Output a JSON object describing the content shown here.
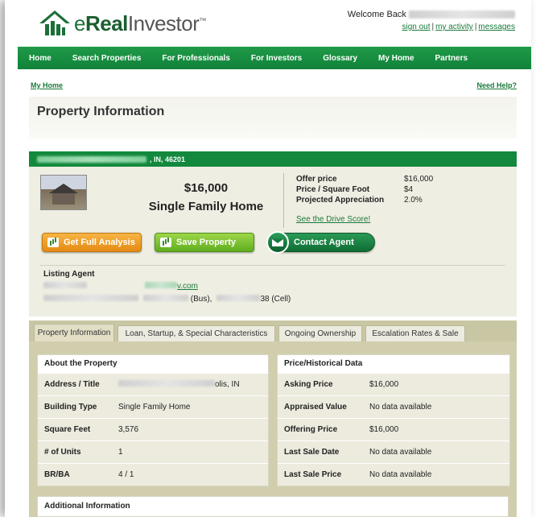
{
  "header": {
    "logo_brand": "Real",
    "logo_prefix": "e",
    "logo_suffix": "Investor",
    "logo_tm": "™",
    "welcome_text": "Welcome Back",
    "links": [
      "sign out",
      "my activity",
      "messages"
    ]
  },
  "nav": {
    "items": [
      "Home",
      "Search Properties",
      "For Professionals",
      "For Investors",
      "Glossary",
      "My Home",
      "Partners"
    ]
  },
  "breadcrumb": {
    "home": "My Home",
    "help": "Need Help?"
  },
  "page_title": "Property Information",
  "address_bar": {
    "visible_suffix": ", IN, 46201"
  },
  "summary": {
    "price": "$16,000",
    "property_type": "Single Family Home",
    "offer": [
      {
        "label": "Offer price",
        "value": "$16,000"
      },
      {
        "label": "Price / Square Foot",
        "value": "$4"
      },
      {
        "label": "Projected Appreciation",
        "value": "2.0%"
      }
    ],
    "drive_score_link": "See the Drive Score!",
    "buttons": {
      "analysis": "Get Full Analysis",
      "save": "Save Property",
      "contact": "Contact Agent"
    }
  },
  "agent": {
    "heading": "Listing Agent",
    "email_visible": "v.com",
    "email_prefix_visible": "",
    "bus_label": "(Bus),",
    "cell_visible": "38 (Cell)"
  },
  "tabs": [
    "Property Information",
    "Loan, Startup, & Special Characteristics",
    "Ongoing Ownership",
    "Escalation Rates & Sale"
  ],
  "about": {
    "heading": "About the Property",
    "rows": [
      {
        "label": "Address / Title",
        "value": "olis, IN"
      },
      {
        "label": "Building Type",
        "value": "Single Family Home"
      },
      {
        "label": "Square Feet",
        "value": "3,576"
      },
      {
        "label": "# of Units",
        "value": "1"
      },
      {
        "label": "BR/BA",
        "value": "4 / 1"
      }
    ]
  },
  "price_history": {
    "heading": "Price/Historical Data",
    "rows": [
      {
        "label": "Asking Price",
        "value": "$16,000"
      },
      {
        "label": "Appraised Value",
        "value": "No data available"
      },
      {
        "label": "Offering Price",
        "value": "$16,000"
      },
      {
        "label": "Last Sale Date",
        "value": "No data available"
      },
      {
        "label": "Last Sale Price",
        "value": "No data available"
      }
    ]
  },
  "additional_heading": "Additional Information",
  "colors": {
    "brand_green": "#13893d",
    "link_green": "#1a7a3a",
    "orange_button": "#e58a14",
    "lime_button": "#5fae1f"
  }
}
